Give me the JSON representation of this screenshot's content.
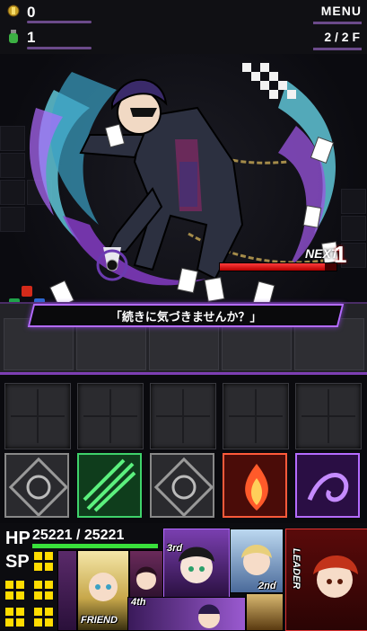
{
  "status": {
    "keys": "0",
    "potions": "1",
    "menu_label": "MENU",
    "floor": "2 / 2 F"
  },
  "enemy": {
    "next_label": "NEXT",
    "next_turns": "1",
    "hp_fraction": 0.9,
    "dialog": "「続きに気づきませんか？」"
  },
  "orbs": [
    {
      "name": "orb-slot-1",
      "element": "none",
      "color": "#6a6a70"
    },
    {
      "name": "orb-slot-2",
      "element": "wood",
      "color": "#1fa34a"
    },
    {
      "name": "orb-slot-3",
      "element": "none",
      "color": "#6a6a70"
    },
    {
      "name": "orb-slot-4",
      "element": "fire",
      "color": "#d32a1a"
    },
    {
      "name": "orb-slot-5",
      "element": "dark",
      "color": "#8a3fd6"
    }
  ],
  "party": {
    "hp_label": "HP",
    "hp_current": "25221",
    "hp_sep": "/",
    "hp_max": "25221",
    "sp_label": "SP",
    "friend_tag": "FRIEND",
    "second_tag": "2nd",
    "third_tag": "3rd",
    "fourth_tag": "4th",
    "leader_tag": "LEADER"
  }
}
